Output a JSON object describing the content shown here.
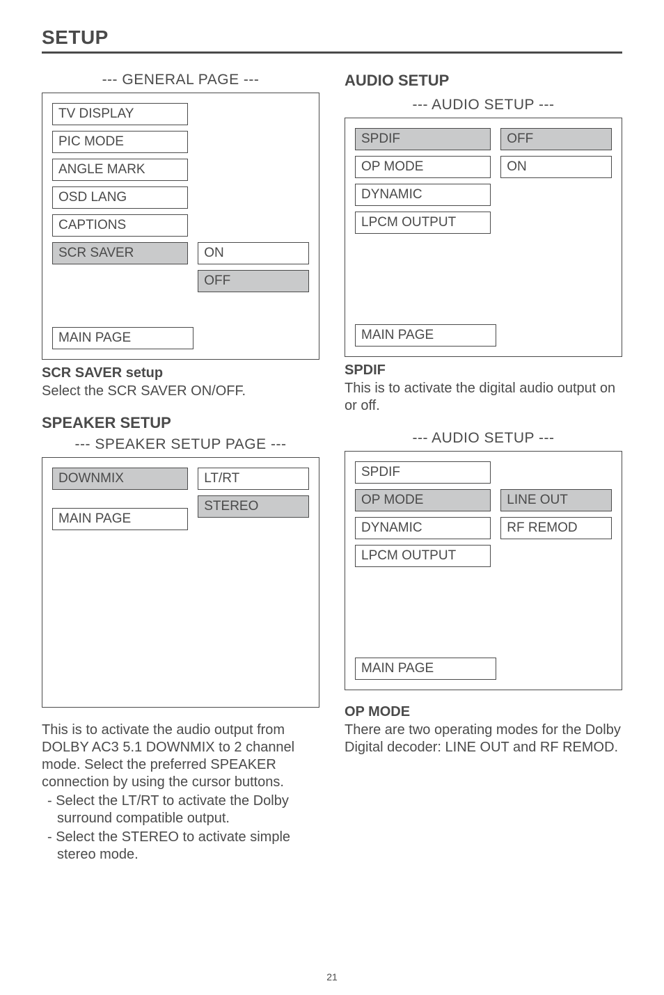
{
  "page": {
    "title": "SETUP",
    "number": "21"
  },
  "left": {
    "general_title": "--- GENERAL PAGE ---",
    "general_items": [
      "TV DISPLAY",
      "PIC MODE",
      "ANGLE MARK",
      "OSD LANG",
      "CAPTIONS",
      "SCR SAVER"
    ],
    "general_options": [
      "ON",
      "OFF"
    ],
    "general_main": "MAIN PAGE",
    "scr_heading": "SCR SAVER setup",
    "scr_text": "Select the SCR SAVER ON/OFF.",
    "speaker_heading": "SPEAKER SETUP",
    "speaker_title": "--- SPEAKER SETUP PAGE ---",
    "speaker_items": [
      "DOWNMIX"
    ],
    "speaker_options": [
      "LT/RT",
      "STEREO"
    ],
    "speaker_main": "MAIN PAGE",
    "speaker_para": "This is to activate the audio output from DOLBY AC3 5.1 DOWNMIX to 2 channel mode.  Select the preferred SPEAKER connection by using the cursor buttons.",
    "speaker_b1": "-  Select the LT/RT to activate the Dolby surround compatible output.",
    "speaker_b2": "-  Select the STEREO to activate simple stereo mode."
  },
  "right": {
    "audio_heading": "AUDIO SETUP",
    "audio_title1": "--- AUDIO SETUP ---",
    "audio1_items": [
      "SPDIF",
      "OP MODE",
      "DYNAMIC",
      "LPCM OUTPUT"
    ],
    "audio1_options": [
      "OFF",
      "ON"
    ],
    "audio1_main": "MAIN PAGE",
    "spdif_heading": "SPDIF",
    "spdif_text": "This is to activate the digital audio output on or off.",
    "audio_title2": "--- AUDIO SETUP ---",
    "audio2_items": [
      "SPDIF",
      "OP MODE",
      "DYNAMIC",
      "LPCM OUTPUT"
    ],
    "audio2_options": [
      "LINE OUT",
      "RF REMOD"
    ],
    "audio2_main": "MAIN PAGE",
    "opmode_heading": "OP MODE",
    "opmode_text": "There are two operating modes for the Dolby Digital decoder:  LINE OUT and RF REMOD."
  }
}
